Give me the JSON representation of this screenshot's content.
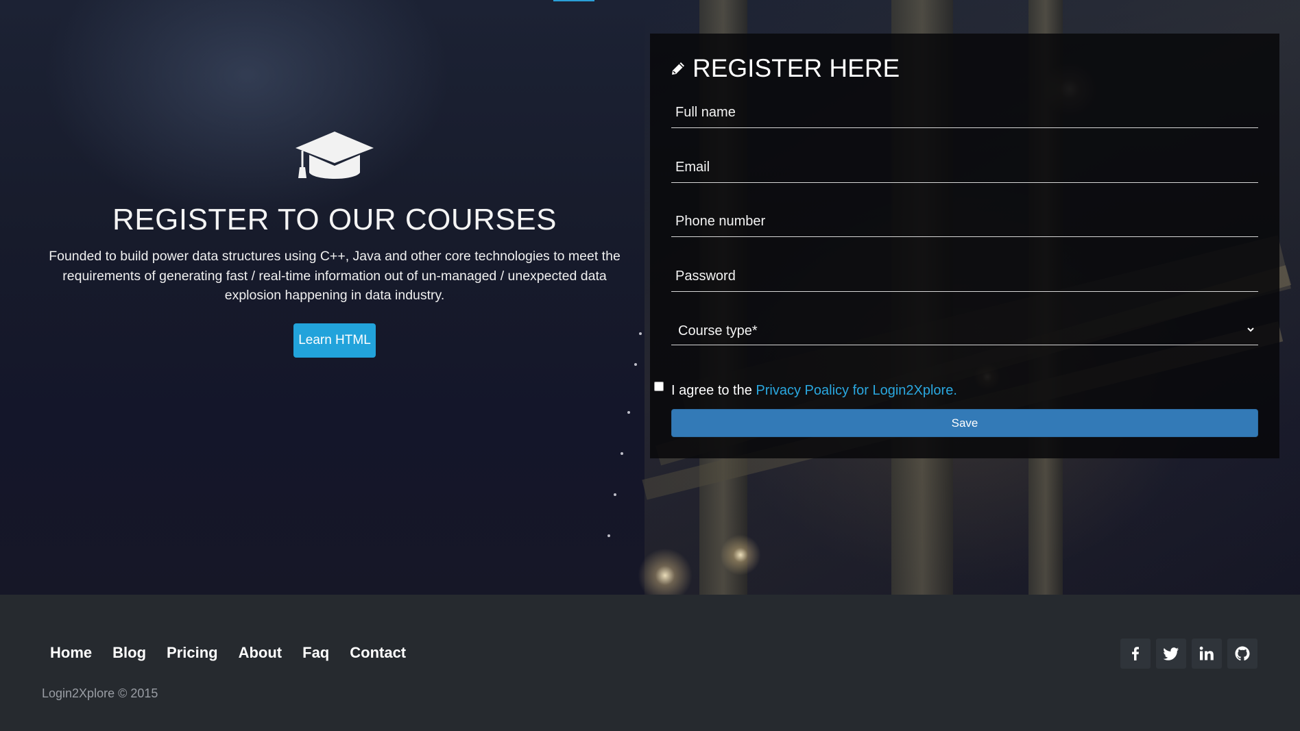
{
  "hero": {
    "title": "REGISTER TO OUR COURSES",
    "description": "Founded to build power data structures using C++, Java and other core technologies to meet the requirements of generating fast / real-time information out of un-managed / unexpected data explosion happening in data industry.",
    "cta_label": "Learn HTML",
    "icon": "graduation-cap-icon"
  },
  "form": {
    "title": "REGISTER HERE",
    "title_icon": "pencil-icon",
    "fields": {
      "full_name": {
        "placeholder": "Full name",
        "value": ""
      },
      "email": {
        "placeholder": "Email",
        "value": ""
      },
      "phone": {
        "placeholder": "Phone number",
        "value": ""
      },
      "password": {
        "placeholder": "Password",
        "value": ""
      }
    },
    "course_select": {
      "selected": "Course type*"
    },
    "agree": {
      "prefix": "I agree to the ",
      "link_text": "Privacy Poalicy for Login2Xplore.",
      "checked": false
    },
    "save_label": "Save"
  },
  "footer": {
    "nav": [
      "Home",
      "Blog",
      "Pricing",
      "About",
      "Faq",
      "Contact"
    ],
    "copyright": "Login2Xplore © 2015",
    "socials": [
      "facebook-icon",
      "twitter-icon",
      "linkedin-icon",
      "github-icon"
    ]
  },
  "colors": {
    "accent": "#22a3db",
    "save_button": "#337ab7",
    "link": "#2aa8e0",
    "footer_bg": "#262a2f"
  }
}
